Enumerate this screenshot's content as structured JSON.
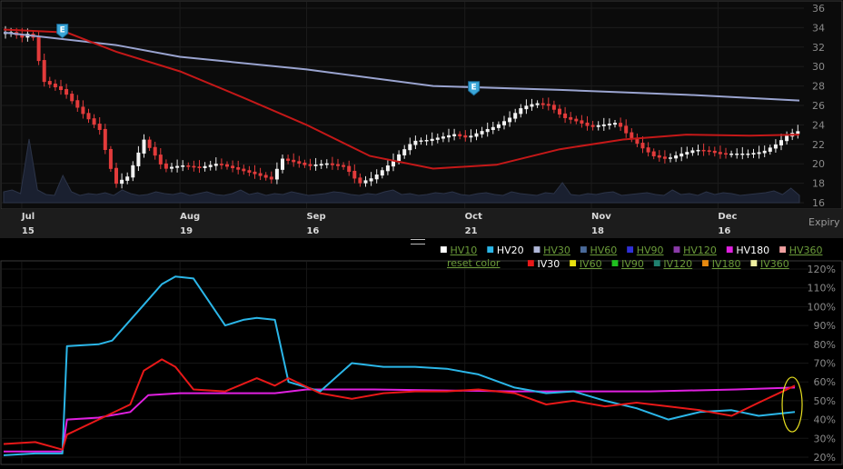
{
  "chart_data": [
    {
      "type": "candlestick",
      "title": "",
      "ylim": [
        16,
        36
      ],
      "y_ticks": [
        "36",
        "34",
        "32",
        "30",
        "28",
        "26",
        "24",
        "22",
        "20",
        "18",
        "16"
      ],
      "x_ticks": [
        {
          "month": "Jul",
          "day": "15"
        },
        {
          "month": "Aug",
          "day": "19"
        },
        {
          "month": "Sep",
          "day": "16"
        },
        {
          "month": "Oct",
          "day": "21"
        },
        {
          "month": "Nov",
          "day": "18"
        },
        {
          "month": "Dec",
          "day": "16"
        }
      ],
      "x_axis_end_label": "Expiry",
      "earnings_markers": [
        {
          "date": "Jul 24",
          "label": "E"
        },
        {
          "date": "Oct 23",
          "label": "E"
        }
      ],
      "moving_average_red": {
        "x": [
          "Jul 11",
          "Jul 25",
          "Aug 05",
          "Aug 19",
          "Sep 02",
          "Sep 16",
          "Sep 30",
          "Oct 14",
          "Oct 28",
          "Nov 11",
          "Nov 25",
          "Dec 09",
          "Dec 23",
          "Jan 03"
        ],
        "values": [
          33.8,
          33.5,
          31.5,
          29.5,
          26.8,
          24.0,
          20.8,
          19.5,
          19.9,
          21.5,
          22.5,
          23.0,
          22.9,
          23.0
        ]
      },
      "moving_average_blue": {
        "x": [
          "Jul 11",
          "Aug 05",
          "Aug 19",
          "Sep 16",
          "Oct 14",
          "Nov 11",
          "Dec 09",
          "Jan 03"
        ],
        "values": [
          33.5,
          32.2,
          31.0,
          29.7,
          28.0,
          27.6,
          27.1,
          26.5
        ]
      }
    },
    {
      "type": "line",
      "ylim": [
        20,
        120
      ],
      "y_ticks": [
        "120%",
        "110%",
        "100%",
        "90%",
        "80%",
        "70%",
        "60%",
        "50%",
        "40%",
        "30%",
        "20%"
      ],
      "series": [
        {
          "name": "HV20",
          "color": "#2bb6e8",
          "x": [
            "Jul 11",
            "Jul 18",
            "Jul 24",
            "Jul 25",
            "Aug 01",
            "Aug 04",
            "Aug 11",
            "Aug 15",
            "Aug 18",
            "Aug 22",
            "Aug 29",
            "Sep 02",
            "Sep 05",
            "Sep 09",
            "Sep 12",
            "Sep 19",
            "Sep 26",
            "Oct 03",
            "Oct 10",
            "Oct 17",
            "Oct 24",
            "Nov 01",
            "Nov 08",
            "Nov 14",
            "Nov 21",
            "Nov 28",
            "Dec 05",
            "Dec 12",
            "Dec 19",
            "Dec 25",
            "Jan 02"
          ],
          "values": [
            21,
            22,
            22,
            79,
            80,
            82,
            101,
            112,
            116,
            115,
            90,
            93,
            94,
            93,
            60,
            55,
            70,
            68,
            68,
            67,
            64,
            57,
            54,
            55,
            50,
            46,
            40,
            44,
            45,
            42,
            44
          ]
        },
        {
          "name": "IV30",
          "color": "#e81818",
          "x": [
            "Jul 11",
            "Jul 18",
            "Jul 24",
            "Jul 25",
            "Aug 01",
            "Aug 08",
            "Aug 11",
            "Aug 15",
            "Aug 18",
            "Aug 22",
            "Aug 29",
            "Sep 05",
            "Sep 09",
            "Sep 12",
            "Sep 19",
            "Sep 26",
            "Oct 03",
            "Oct 10",
            "Oct 17",
            "Oct 24",
            "Nov 01",
            "Nov 08",
            "Nov 14",
            "Nov 21",
            "Nov 28",
            "Dec 05",
            "Dec 12",
            "Dec 19",
            "Dec 25",
            "Jan 02"
          ],
          "values": [
            27,
            28,
            24,
            32,
            40,
            48,
            66,
            72,
            68,
            56,
            55,
            62,
            58,
            62,
            54,
            51,
            54,
            55,
            55,
            56,
            54,
            48,
            50,
            47,
            49,
            47,
            45,
            42,
            49,
            58
          ]
        },
        {
          "name": "HV180",
          "color": "#e020e0",
          "x": [
            "Jul 11",
            "Jul 24",
            "Jul 25",
            "Aug 01",
            "Aug 08",
            "Aug 12",
            "Aug 19",
            "Sep 09",
            "Sep 16",
            "Oct 01",
            "Nov 01",
            "Dec 01",
            "Dec 20",
            "Jan 02"
          ],
          "values": [
            23,
            23,
            40,
            41,
            44,
            53,
            54,
            54,
            56,
            56,
            55,
            55,
            56,
            57
          ]
        }
      ],
      "legend": {
        "row1": [
          {
            "label": "HV10",
            "color": "#ffffff",
            "active": false
          },
          {
            "label": "HV20",
            "color": "#2bb6e8",
            "active": true
          },
          {
            "label": "HV30",
            "color": "#b0b8d8",
            "active": false
          },
          {
            "label": "HV60",
            "color": "#4a6a9a",
            "active": false
          },
          {
            "label": "HV90",
            "color": "#3030d8",
            "active": false
          },
          {
            "label": "HV120",
            "color": "#8a3aa8",
            "active": false
          },
          {
            "label": "HV180",
            "color": "#e020e0",
            "active": true
          },
          {
            "label": "HV360",
            "color": "#f0a0a0",
            "active": false
          }
        ],
        "row2": [
          {
            "label": "IV30",
            "color": "#e81818",
            "active": true
          },
          {
            "label": "IV60",
            "color": "#e8e010",
            "active": false
          },
          {
            "label": "IV90",
            "color": "#20c020",
            "active": false
          },
          {
            "label": "IV120",
            "color": "#208070",
            "active": false
          },
          {
            "label": "IV180",
            "color": "#e88a10",
            "active": false
          },
          {
            "label": "IV360",
            "color": "#f0f0a0",
            "active": false
          }
        ],
        "reset_label": "reset color"
      },
      "highlight": {
        "shape": "ellipse",
        "color": "#e8e020",
        "around": "last point",
        "date": "Jan 02"
      }
    }
  ]
}
